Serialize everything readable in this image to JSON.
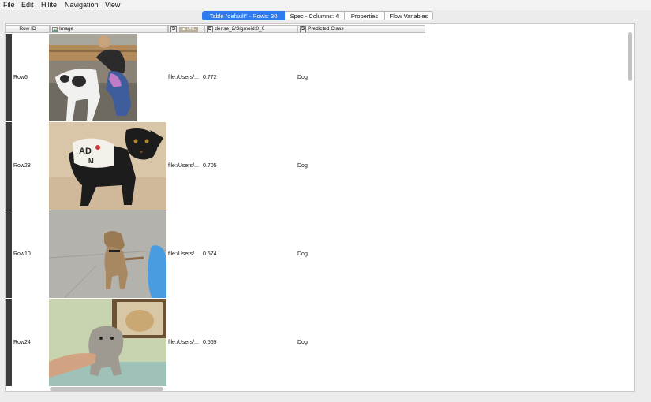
{
  "menu": [
    "File",
    "Edit",
    "Hilite",
    "Navigation",
    "View"
  ],
  "tabs": [
    {
      "label": "Table \"default\" - Rows: 30",
      "active": true
    },
    {
      "label": "Spec - Columns: 4",
      "active": false
    },
    {
      "label": "Properties",
      "active": false
    },
    {
      "label": "Flow Variables",
      "active": false
    }
  ],
  "columns": {
    "row_id": "Row ID",
    "image": "Image",
    "url_type": "S",
    "url": "URL",
    "sigmoid_type": "D",
    "sigmoid": "dense_2/Sigmoid:0_0",
    "class_type": "S",
    "class": "Predicted Class"
  },
  "rows": [
    {
      "id": "Row6",
      "url": "file:/Users/...",
      "sigmoid": "0.772",
      "class": "Dog",
      "image_icon": "dog-and-girl-photo"
    },
    {
      "id": "Row28",
      "url": "file:/Users/...",
      "sigmoid": "0.705",
      "class": "Dog",
      "image_icon": "black-puppy-adopt-vest-photo"
    },
    {
      "id": "Row10",
      "url": "file:/Users/...",
      "sigmoid": "0.574",
      "class": "Dog",
      "image_icon": "tan-dog-standing-photo"
    },
    {
      "id": "Row24",
      "url": "file:/Users/...",
      "sigmoid": "0.569",
      "class": "Dog",
      "image_icon": "grey-puppy-on-lap-photo"
    }
  ]
}
